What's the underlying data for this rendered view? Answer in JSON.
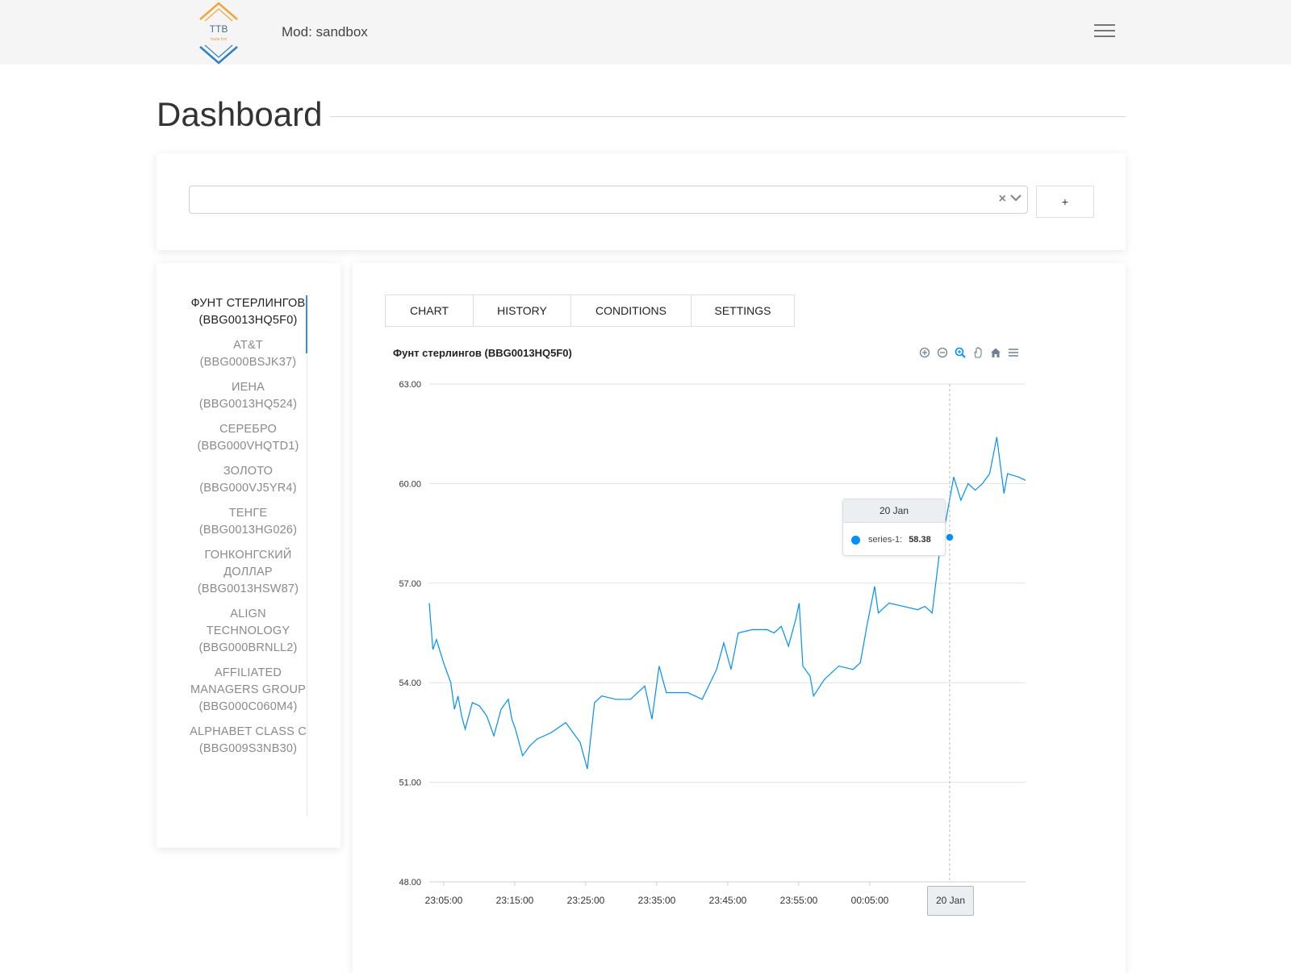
{
  "header": {
    "logo_text": "TTB",
    "logo_subtext": "trade bot",
    "mode_label": "Mod: sandbox",
    "menu_icon": "hamburger-menu-icon"
  },
  "page": {
    "title": "Dashboard"
  },
  "select": {
    "value": "",
    "clear_icon": "×",
    "add_label": "+"
  },
  "instruments": [
    {
      "label": "ФУНТ СТЕРЛИНГОВ (BBG0013HQ5F0)",
      "active": true
    },
    {
      "label": "AT&T (BBG000BSJK37)"
    },
    {
      "label": "ИЕНА (BBG0013HQ524)"
    },
    {
      "label": "СЕРЕБРО (BBG000VHQTD1)"
    },
    {
      "label": "ЗОЛОТО (BBG000VJ5YR4)"
    },
    {
      "label": "ТЕНГЕ (BBG0013HG026)"
    },
    {
      "label": "ГОНКОНГСКИЙ ДОЛЛАР (BBG0013HSW87)"
    },
    {
      "label": "ALIGN TECHNOLOGY (BBG000BRNLL2)"
    },
    {
      "label": "AFFILIATED MANAGERS GROUP (BBG000C060M4)"
    },
    {
      "label": "ALPHABET CLASS C (BBG009S3NB30)"
    }
  ],
  "tabs": [
    {
      "label": "CHART",
      "active": true
    },
    {
      "label": "HISTORY"
    },
    {
      "label": "CONDITIONS"
    },
    {
      "label": "SETTINGS"
    }
  ],
  "chart_toolbar": [
    "zoom-in-icon",
    "zoom-out-icon",
    "selection-zoom-icon",
    "pan-icon",
    "reset-home-icon",
    "menu-icon"
  ],
  "tooltip": {
    "title": "20 Jan",
    "series_label": "series-1:",
    "value": "58.38",
    "x_tooltip": "20 Jan"
  },
  "colors": {
    "series": "#008ffb",
    "accent": "#2b93e8"
  },
  "chart_data": {
    "type": "line",
    "title": "Фунт стерлингов (BBG0013HQ5F0)",
    "ylim": [
      48,
      63
    ],
    "yticks": [
      "63.00",
      "60.00",
      "57.00",
      "54.00",
      "51.00",
      "48.00"
    ],
    "xticks": [
      "23:05:00",
      "23:15:00",
      "23:25:00",
      "23:35:00",
      "23:45:00",
      "23:55:00",
      "00:05:00"
    ],
    "grid": true,
    "series": [
      {
        "name": "series-1",
        "points": [
          [
            0,
            56.4
          ],
          [
            0.5,
            55.0
          ],
          [
            1,
            55.3
          ],
          [
            2,
            54.6
          ],
          [
            3,
            54.0
          ],
          [
            3.5,
            53.2
          ],
          [
            4,
            53.6
          ],
          [
            4.5,
            53.0
          ],
          [
            5,
            52.6
          ],
          [
            6,
            53.4
          ],
          [
            7,
            53.3
          ],
          [
            8,
            53.0
          ],
          [
            9,
            52.4
          ],
          [
            10,
            53.2
          ],
          [
            11,
            53.5
          ],
          [
            11.5,
            52.9
          ],
          [
            12,
            52.6
          ],
          [
            13,
            51.8
          ],
          [
            14,
            52.1
          ],
          [
            15,
            52.3
          ],
          [
            17,
            52.5
          ],
          [
            19,
            52.8
          ],
          [
            21,
            52.2
          ],
          [
            22,
            51.4
          ],
          [
            23,
            53.4
          ],
          [
            24,
            53.6
          ],
          [
            26,
            53.5
          ],
          [
            28,
            53.5
          ],
          [
            30,
            53.9
          ],
          [
            31,
            52.9
          ],
          [
            32,
            54.5
          ],
          [
            33,
            53.7
          ],
          [
            36,
            53.7
          ],
          [
            38,
            53.5
          ],
          [
            40,
            54.4
          ],
          [
            41,
            55.2
          ],
          [
            42,
            54.4
          ],
          [
            43,
            55.5
          ],
          [
            45,
            55.6
          ],
          [
            47,
            55.6
          ],
          [
            48,
            55.5
          ],
          [
            49,
            55.7
          ],
          [
            50,
            55.1
          ],
          [
            51,
            55.9
          ],
          [
            51.5,
            56.4
          ],
          [
            52,
            54.5
          ],
          [
            53,
            54.2
          ],
          [
            53.5,
            53.6
          ],
          [
            55,
            54.1
          ],
          [
            57,
            54.5
          ],
          [
            59,
            54.4
          ],
          [
            60,
            54.6
          ],
          [
            61,
            55.8
          ],
          [
            62,
            56.9
          ],
          [
            62.5,
            56.1
          ],
          [
            64,
            56.4
          ],
          [
            66,
            56.3
          ],
          [
            68,
            56.2
          ],
          [
            69,
            56.3
          ],
          [
            70,
            56.1
          ],
          [
            71,
            57.9
          ],
          [
            72,
            59.0
          ],
          [
            73,
            60.2
          ],
          [
            74,
            59.5
          ],
          [
            75,
            60.0
          ],
          [
            76,
            59.8
          ],
          [
            77,
            60.0
          ],
          [
            78,
            60.3
          ],
          [
            79,
            61.4
          ],
          [
            80,
            59.7
          ],
          [
            80.5,
            60.3
          ],
          [
            82,
            60.2
          ],
          [
            83,
            60.1
          ]
        ]
      }
    ],
    "crosshair": {
      "x_label": "20 Jan",
      "value": 58.38
    }
  }
}
